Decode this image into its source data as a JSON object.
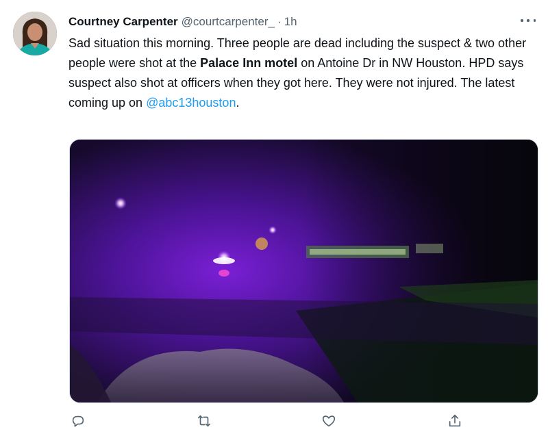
{
  "tweet": {
    "display_name": "Courtney Carpenter",
    "handle": "@courtcarpenter_",
    "separator": "·",
    "time": "1h",
    "text": {
      "part1": "Sad situation this morning. Three people are dead including the suspect & two other people were shot at the ",
      "bold": "Palace Inn motel",
      "part2": " on Antoine Dr in NW Houston. HPD says suspect also shot at officers when they got here. They were not injured. The latest coming up on ",
      "mention": "@abc13houston",
      "part3": "."
    }
  },
  "icons": {
    "more": "more-dots-icon",
    "reply": "reply-icon",
    "retweet": "retweet-icon",
    "like": "heart-icon",
    "share": "share-icon"
  },
  "colors": {
    "link": "#1d9bf0",
    "secondary_text": "#536471",
    "primary_text": "#0f1419"
  }
}
